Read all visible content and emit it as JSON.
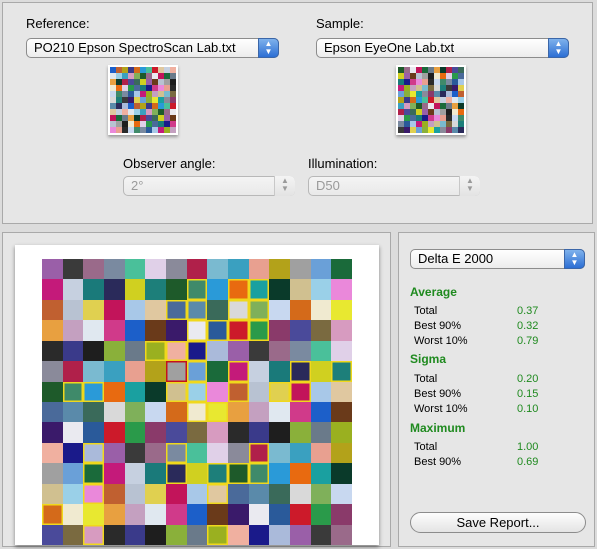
{
  "reference": {
    "label": "Reference:",
    "selected": "PO210 Epson SpectroScan Lab.txt"
  },
  "sample": {
    "label": "Sample:",
    "selected": "Epson EyeOne Lab.txt"
  },
  "observer": {
    "label": "Observer angle:",
    "selected": "2°"
  },
  "illumination": {
    "label": "Illumination:",
    "selected": "D50"
  },
  "metric": {
    "selected": "Delta E 2000"
  },
  "stats": {
    "average": {
      "title": "Average",
      "rows": [
        {
          "label": "Total",
          "value": "0.37"
        },
        {
          "label": "Best 90%",
          "value": "0.32"
        },
        {
          "label": "Worst 10%",
          "value": "0.79"
        }
      ]
    },
    "sigma": {
      "title": "Sigma",
      "rows": [
        {
          "label": "Total",
          "value": "0.20"
        },
        {
          "label": "Best 90%",
          "value": "0.15"
        },
        {
          "label": "Worst 10%",
          "value": "0.10"
        }
      ]
    },
    "maximum": {
      "title": "Maximum",
      "rows": [
        {
          "label": "Total",
          "value": "1.00"
        },
        {
          "label": "Best 90%",
          "value": "0.69"
        }
      ]
    }
  },
  "save_button": "Save Report...",
  "colors": {
    "accent": "#1f8a1f",
    "highlight": "#f0d81c",
    "worst": "#c4121b"
  },
  "icons": {
    "popup": "up-down-arrows-icon"
  }
}
